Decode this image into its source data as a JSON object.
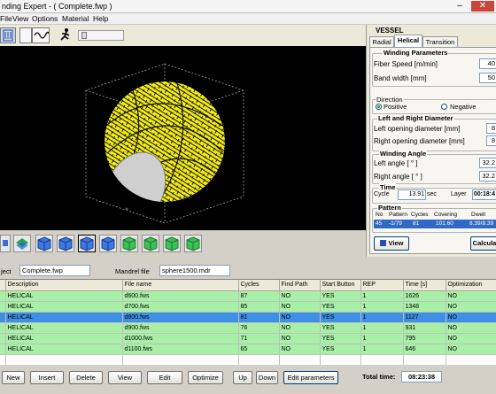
{
  "window": {
    "title": "nding Expert - ( Complete.fwp )"
  },
  "menu": [
    "File",
    "View",
    "Options",
    "Material",
    "Help"
  ],
  "panel": {
    "header": "VESSEL",
    "tabs": [
      "Radial",
      "Helical",
      "Transition"
    ],
    "winding_parameters": {
      "title": "Winding Parameters",
      "fiber_speed_label": "Fiber Speed  [m/min]",
      "fiber_speed": "40",
      "band_width_label": "Band width  [mm]",
      "band_width": "50"
    },
    "direction": {
      "title": "Direction",
      "positive": "Positive",
      "negative": "Negative",
      "selected": "Positive"
    },
    "diameters": {
      "title": "Left and Right Diameter",
      "left_label": "Left opening diameter   [mm]",
      "left": "8",
      "right_label": "Right opening diameter  [mm]",
      "right": "8"
    },
    "winding_angle": {
      "title": "Winding Angle",
      "left_label": "Left angle [ ° ]",
      "left": "32.2",
      "right_label": "Right angle [ ° ]",
      "right": "32.2"
    },
    "time": {
      "title": "Time",
      "cycle_label": "Cycle",
      "cycle": "13.91",
      "cycle_unit": "sec",
      "layer_label": "Layer",
      "layer": "00:18:4"
    },
    "pattern": {
      "title": "Pattern",
      "headers": [
        "No",
        "Pattern",
        "Cycles",
        "Covering",
        "Dwell"
      ],
      "row": [
        "45",
        "-1/79",
        "81",
        "101.60",
        "8.39/8.39"
      ]
    },
    "view_button": "View",
    "calc_button": "Calcula"
  },
  "project": {
    "object_label": "ject",
    "object_value": "Complete.fwp",
    "mandrel_label": "Mandrel file",
    "mandrel_value": "sphere1500.mdr"
  },
  "table": {
    "headers": [
      "",
      "Description",
      "File name",
      "Cycles",
      "Find Path",
      "Start Button",
      "REP",
      "Time [s]",
      "Optimization"
    ],
    "rows": [
      {
        "cells": [
          "",
          "HELICAL",
          "d600.fws",
          "87",
          "NO",
          "YES",
          "1",
          "1626",
          "NO"
        ],
        "state": "g"
      },
      {
        "cells": [
          "",
          "HELICAL",
          "d700.fws",
          "85",
          "NO",
          "YES",
          "1",
          "1348",
          "NO"
        ],
        "state": "g"
      },
      {
        "cells": [
          "",
          "HELICAL",
          "d800.fws",
          "81",
          "NO",
          "YES",
          "1",
          "1127",
          "NO"
        ],
        "state": "s"
      },
      {
        "cells": [
          "",
          "HELICAL",
          "d900.fws",
          "76",
          "NO",
          "YES",
          "1",
          "931",
          "NO"
        ],
        "state": "g"
      },
      {
        "cells": [
          "",
          "HELICAL",
          "d1000.fws",
          "71",
          "NO",
          "YES",
          "1",
          "795",
          "NO"
        ],
        "state": "g"
      },
      {
        "cells": [
          "",
          "HELICAL",
          "d1100.fws",
          "65",
          "NO",
          "YES",
          "1",
          "646",
          "NO"
        ],
        "state": "g"
      },
      {
        "cells": [
          "",
          "",
          "",
          "",
          "",
          "",
          "",
          "",
          ""
        ],
        "state": "e"
      }
    ]
  },
  "bottom": {
    "buttons": [
      "New",
      "Insert",
      "Delete",
      "View",
      "Edit",
      "Optimize",
      "Up",
      "Down",
      "Edit parameters"
    ],
    "total_label": "Total time:",
    "total_value": "08:23:38"
  },
  "colors": {
    "wind": "#f4ec10",
    "selected_row": "#3e8fe6",
    "ok_row": "#a8f0a8",
    "viewport_bg": "#000000"
  },
  "icons": [
    "gear-wheel-icon",
    "sine-wave-icon",
    "running-man-icon",
    "zoom-cube-icon",
    "view-cube-icon"
  ]
}
